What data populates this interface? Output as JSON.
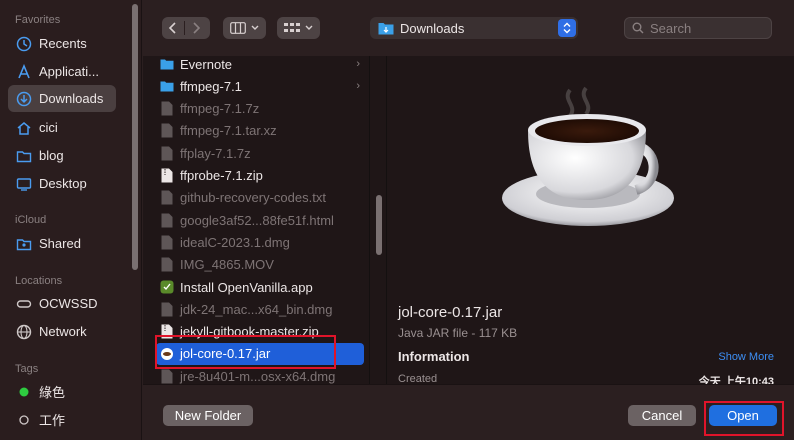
{
  "sidebar": {
    "sections": {
      "favorites": "Favorites",
      "icloud": "iCloud",
      "locations": "Locations",
      "tags": "Tags"
    },
    "items": [
      {
        "label": "Recents",
        "icon": "clock-icon"
      },
      {
        "label": "Applicati...",
        "icon": "applications-icon"
      },
      {
        "label": "Downloads",
        "icon": "download-icon"
      },
      {
        "label": "cici",
        "icon": "home-icon"
      },
      {
        "label": "blog",
        "icon": "folder-icon"
      },
      {
        "label": "Desktop",
        "icon": "desktop-icon"
      },
      {
        "label": "Shared",
        "icon": "shared-folder-icon"
      },
      {
        "label": "OCWSSD",
        "icon": "drive-icon"
      },
      {
        "label": "Network",
        "icon": "network-icon"
      },
      {
        "label": "綠色",
        "icon": "green-tag-icon"
      },
      {
        "label": "工作",
        "icon": "tag-icon"
      }
    ]
  },
  "toolbar": {
    "location": "Downloads",
    "search_placeholder": "Search"
  },
  "files": [
    {
      "name": "Evernote",
      "type": "folder",
      "dim": false,
      "chevron": true
    },
    {
      "name": "ffmpeg-7.1",
      "type": "folder",
      "dim": false,
      "chevron": true
    },
    {
      "name": "ffmpeg-7.1.7z",
      "type": "file",
      "dim": true
    },
    {
      "name": "ffmpeg-7.1.tar.xz",
      "type": "file",
      "dim": true
    },
    {
      "name": "ffplay-7.1.7z",
      "type": "file",
      "dim": true
    },
    {
      "name": "ffprobe-7.1.zip",
      "type": "zip",
      "dim": false
    },
    {
      "name": "github-recovery-codes.txt",
      "type": "file",
      "dim": true
    },
    {
      "name": "google3af52...88fe51f.html",
      "type": "file",
      "dim": true
    },
    {
      "name": "idealC-2023.1.dmg",
      "type": "file",
      "dim": true
    },
    {
      "name": "IMG_4865.MOV",
      "type": "file",
      "dim": true
    },
    {
      "name": "Install OpenVanilla.app",
      "type": "app",
      "dim": false
    },
    {
      "name": "jdk-24_mac...x64_bin.dmg",
      "type": "file",
      "dim": true
    },
    {
      "name": "jekyll-gitbook-master.zip",
      "type": "zip",
      "dim": false
    },
    {
      "name": "jol-core-0.17.jar",
      "type": "jar",
      "dim": false,
      "selected": true
    },
    {
      "name": "jre-8u401-m...osx-x64.dmg",
      "type": "file",
      "dim": true
    }
  ],
  "preview": {
    "name": "jol-core-0.17.jar",
    "kind": "Java JAR file - 117 KB",
    "info_label": "Information",
    "show_more": "Show More",
    "created_label": "Created",
    "created_value": "今天 上午10:43"
  },
  "buttons": {
    "new_folder": "New Folder",
    "cancel": "Cancel",
    "open": "Open"
  },
  "colors": {
    "accent": "#1f6fe0",
    "selection": "#1f5fd9",
    "highlight_box": "#e0142a",
    "green_tag": "#2ecc40"
  }
}
